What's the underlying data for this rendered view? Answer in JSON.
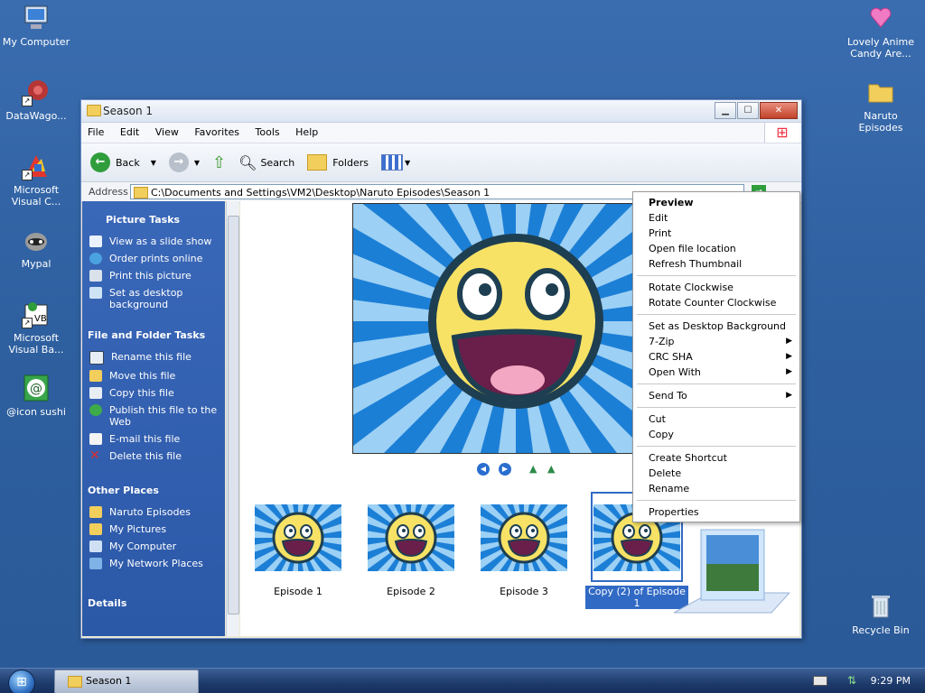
{
  "desktop": {
    "icons_left": [
      {
        "label": "My Computer"
      },
      {
        "label": "DataWago..."
      },
      {
        "label": "Microsoft Visual C..."
      },
      {
        "label": "Mypal"
      },
      {
        "label": "Microsoft Visual Ba..."
      },
      {
        "label": "@icon sushi"
      }
    ],
    "icons_right": [
      {
        "label": "Lovely Anime Candy Are..."
      },
      {
        "label": "Naruto Episodes"
      },
      {
        "label": "Recycle Bin"
      }
    ]
  },
  "window": {
    "title": "Season 1",
    "menu": [
      "File",
      "Edit",
      "View",
      "Favorites",
      "Tools",
      "Help"
    ],
    "toolbar": {
      "back": "Back",
      "search": "Search",
      "folders": "Folders"
    },
    "address_label": "Address",
    "address_value": "C:\\Documents and Settings\\VM2\\Desktop\\Naruto Episodes\\Season 1"
  },
  "taskpane": {
    "picture_tasks": {
      "title": "Picture Tasks",
      "items": [
        "View as a slide show",
        "Order prints online",
        "Print this picture",
        "Set as desktop background"
      ]
    },
    "file_tasks": {
      "title": "File and Folder Tasks",
      "items": [
        "Rename this file",
        "Move this file",
        "Copy this file",
        "Publish this file to the Web",
        "E-mail this file",
        "Delete this file"
      ]
    },
    "other_places": {
      "title": "Other Places",
      "items": [
        "Naruto Episodes",
        "My Pictures",
        "My Computer",
        "My Network Places"
      ]
    },
    "details": {
      "title": "Details"
    }
  },
  "thumbnails": [
    {
      "caption": "Episode 1",
      "selected": false
    },
    {
      "caption": "Episode 2",
      "selected": false
    },
    {
      "caption": "Episode 3",
      "selected": false
    },
    {
      "caption": "Copy (2) of Episode 1",
      "selected": true
    }
  ],
  "context_menu": {
    "items": [
      {
        "label": "Preview",
        "bold": true
      },
      {
        "label": "Edit"
      },
      {
        "label": "Print"
      },
      {
        "label": "Open file location"
      },
      {
        "label": "Refresh Thumbnail"
      },
      {
        "sep": true
      },
      {
        "label": "Rotate Clockwise"
      },
      {
        "label": "Rotate Counter Clockwise"
      },
      {
        "sep": true
      },
      {
        "label": "Set as Desktop Background"
      },
      {
        "label": "7-Zip",
        "submenu": true
      },
      {
        "label": "CRC SHA",
        "submenu": true
      },
      {
        "label": "Open With",
        "submenu": true
      },
      {
        "sep": true
      },
      {
        "label": "Send To",
        "submenu": true
      },
      {
        "sep": true
      },
      {
        "label": "Cut"
      },
      {
        "label": "Copy"
      },
      {
        "sep": true
      },
      {
        "label": "Create Shortcut"
      },
      {
        "label": "Delete"
      },
      {
        "label": "Rename"
      },
      {
        "sep": true
      },
      {
        "label": "Properties"
      }
    ]
  },
  "taskbar": {
    "task_label": "Season 1",
    "clock": "9:29 PM"
  },
  "colors": {
    "desktop": "#2f63a5",
    "taskpane": "#2c58a8",
    "selection": "#316ac5"
  }
}
